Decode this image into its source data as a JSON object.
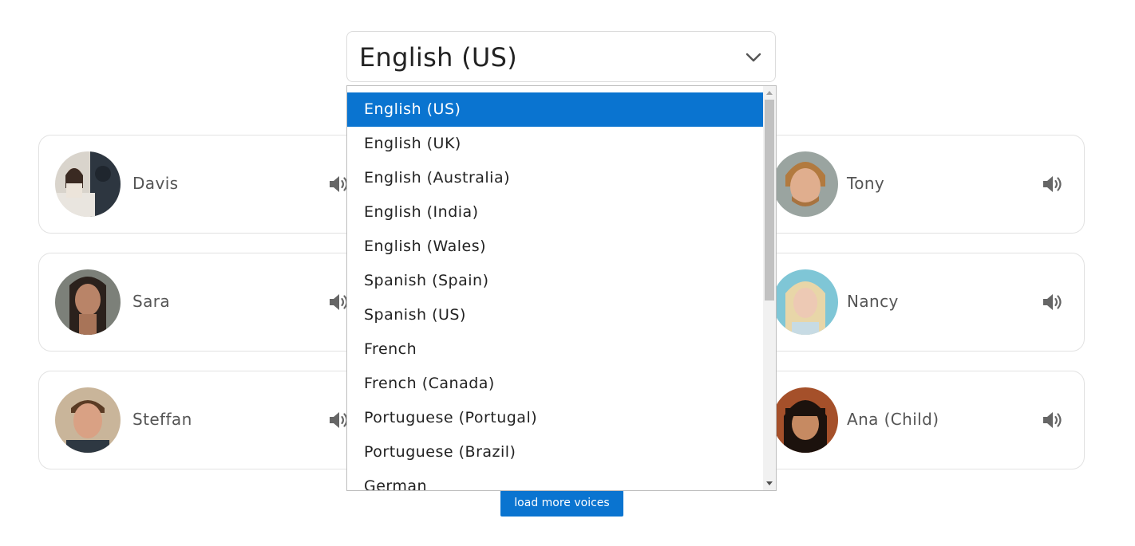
{
  "language_select": {
    "value": "English (US)",
    "options": [
      "English (US)",
      "English (UK)",
      "English (Australia)",
      "English (India)",
      "English (Wales)",
      "Spanish (Spain)",
      "Spanish (US)",
      "French",
      "French (Canada)",
      "Portuguese (Portugal)",
      "Portuguese (Brazil)",
      "German"
    ],
    "selected_option": "English (US)"
  },
  "voices": [
    {
      "name": "Davis",
      "icon": "speaker-icon"
    },
    {
      "name": "Tony",
      "icon": "speaker-icon"
    },
    {
      "name": "Sara",
      "icon": "speaker-icon"
    },
    {
      "name": "Nancy",
      "icon": "speaker-icon"
    },
    {
      "name": "Steffan",
      "icon": "speaker-icon"
    },
    {
      "name": "Ana (Child)",
      "icon": "speaker-icon"
    }
  ],
  "load_more_label": "load more voices",
  "colors": {
    "accent": "#0a74d0",
    "card_border": "#e2e2e2",
    "text": "#555555"
  }
}
